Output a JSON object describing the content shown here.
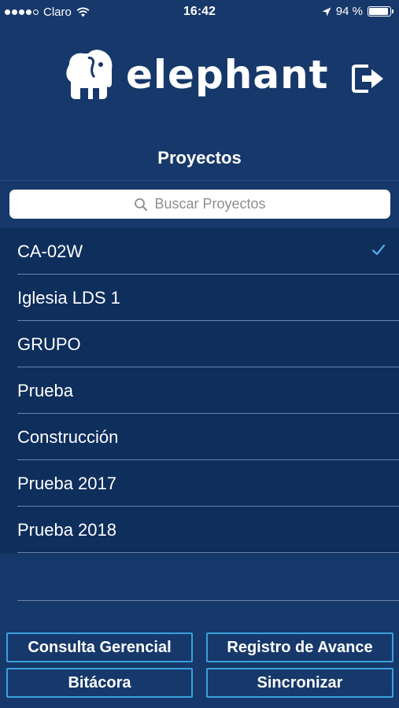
{
  "status_bar": {
    "carrier": "Claro",
    "time": "16:42",
    "battery": "94 %",
    "battery_level": 0.94
  },
  "header": {
    "logo_text": "elephant",
    "logout_icon": "logout-icon"
  },
  "title": "Proyectos",
  "search": {
    "placeholder": "Buscar Proyectos",
    "icon": "search-icon"
  },
  "projects": [
    {
      "name": "CA-02W",
      "selected": true
    },
    {
      "name": "Iglesia LDS 1",
      "selected": false
    },
    {
      "name": "GRUPO",
      "selected": false
    },
    {
      "name": "Prueba",
      "selected": false
    },
    {
      "name": "Construcción",
      "selected": false
    },
    {
      "name": "Prueba 2017",
      "selected": false
    },
    {
      "name": "Prueba 2018",
      "selected": false
    }
  ],
  "buttons": {
    "consulta": "Consulta Gerencial",
    "registro": "Registro de Avance",
    "bitacora": "Bitácora",
    "sincronizar": "Sincronizar"
  },
  "colors": {
    "background": "#17386a",
    "list_background": "#0e2e5c",
    "accent": "#3aa0dc"
  }
}
